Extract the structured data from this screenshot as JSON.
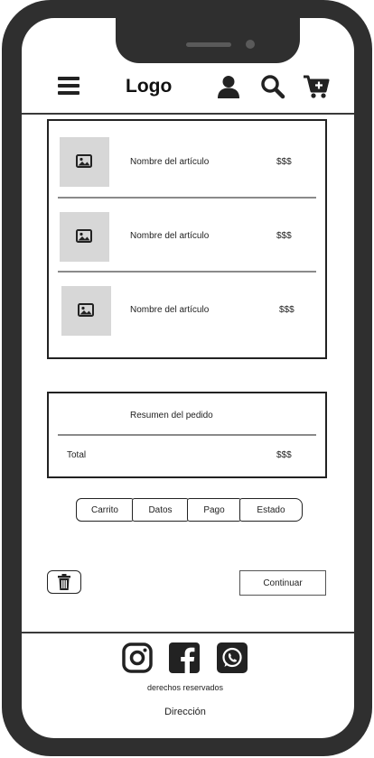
{
  "header": {
    "logo": "Logo",
    "icons": {
      "menu": "hamburger-menu-icon",
      "user": "user-icon",
      "search": "search-icon",
      "cart": "cart-add-icon"
    }
  },
  "cart": {
    "items": [
      {
        "name": "Nombre del artículo",
        "price": "$$$",
        "icon": "image-placeholder-icon"
      },
      {
        "name": "Nombre del artículo",
        "price": "$$$",
        "icon": "image-placeholder-icon"
      },
      {
        "name": "Nombre del artículo",
        "price": "$$$",
        "icon": "image-placeholder-icon"
      }
    ]
  },
  "summary": {
    "title": "Resumen del pedido",
    "total_label": "Total",
    "total_value": "$$$"
  },
  "steps": [
    "Carrito",
    "Datos",
    "Pago",
    "Estado"
  ],
  "actions": {
    "delete_icon": "trash-icon",
    "continue_label": "Continuar"
  },
  "footer": {
    "social": [
      "instagram-icon",
      "facebook-icon",
      "whatsapp-icon"
    ],
    "rights": "derechos reservados",
    "address": "Dirección"
  },
  "colors": {
    "frame": "#2f2f2f",
    "placeholder": "#d7d7d7",
    "divider": "#8a8a8a"
  }
}
